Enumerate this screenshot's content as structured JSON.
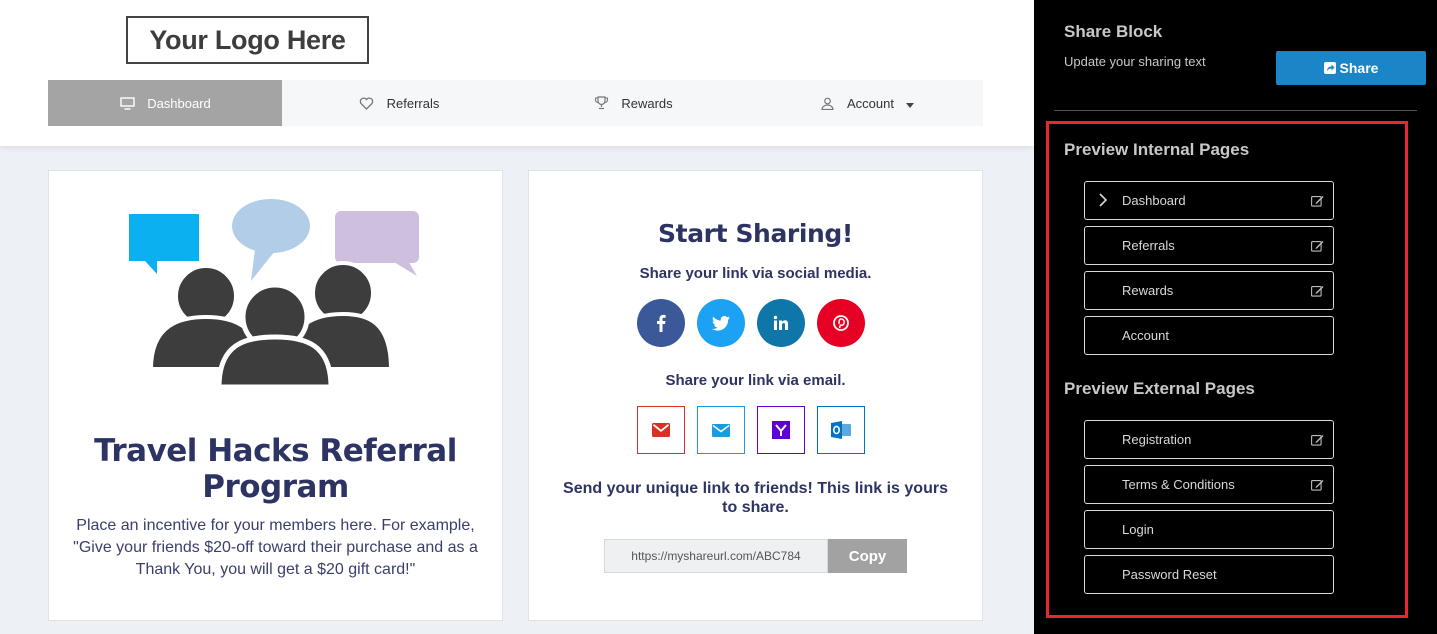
{
  "header": {
    "logo_text": "Your Logo Here",
    "nav": [
      {
        "label": "Dashboard",
        "icon": "monitor-icon",
        "active": true
      },
      {
        "label": "Referrals",
        "icon": "heart-icon",
        "active": false
      },
      {
        "label": "Rewards",
        "icon": "trophy-icon",
        "active": false
      },
      {
        "label": "Account",
        "icon": "user-icon",
        "active": false
      }
    ]
  },
  "program": {
    "title": "Travel Hacks Referral Program",
    "description": "Place an incentive for your members here. For example, \"Give your friends $20-off toward their purchase and as a Thank You, you will get a $20 gift card!\"",
    "illustration": "people-chat-illustration"
  },
  "sharing": {
    "title": "Start Sharing!",
    "social_subtitle": "Share your link via social media.",
    "social": [
      {
        "name": "facebook",
        "color": "#3b5998"
      },
      {
        "name": "twitter",
        "color": "#1da1f2"
      },
      {
        "name": "linkedin",
        "color": "#0e76a8"
      },
      {
        "name": "pinterest",
        "color": "#e60023"
      }
    ],
    "email_subtitle": "Share your link via email.",
    "email": [
      {
        "name": "gmail",
        "color": "#d93025"
      },
      {
        "name": "mail",
        "color": "#1a9be0"
      },
      {
        "name": "yahoo",
        "color": "#6001d2"
      },
      {
        "name": "outlook",
        "color": "#0072c6"
      }
    ],
    "send_text": "Send your unique link to friends! This link is yours to share.",
    "link": "https://myshareurl.com/ABC784",
    "copy_label": "Copy"
  },
  "sidebar": {
    "title": "Share Block",
    "subtitle": "Update your sharing text",
    "share_label": "Share",
    "internal_title": "Preview Internal Pages",
    "internal_pages": [
      {
        "label": "Dashboard",
        "editable": true,
        "current": true
      },
      {
        "label": "Referrals",
        "editable": true,
        "current": false
      },
      {
        "label": "Rewards",
        "editable": true,
        "current": false
      },
      {
        "label": "Account",
        "editable": false,
        "current": false
      }
    ],
    "external_title": "Preview External Pages",
    "external_pages": [
      {
        "label": "Registration",
        "editable": true
      },
      {
        "label": "Terms & Conditions",
        "editable": true
      },
      {
        "label": "Login",
        "editable": false
      },
      {
        "label": "Password Reset",
        "editable": false
      }
    ],
    "highlight_color": "#e8282e"
  }
}
